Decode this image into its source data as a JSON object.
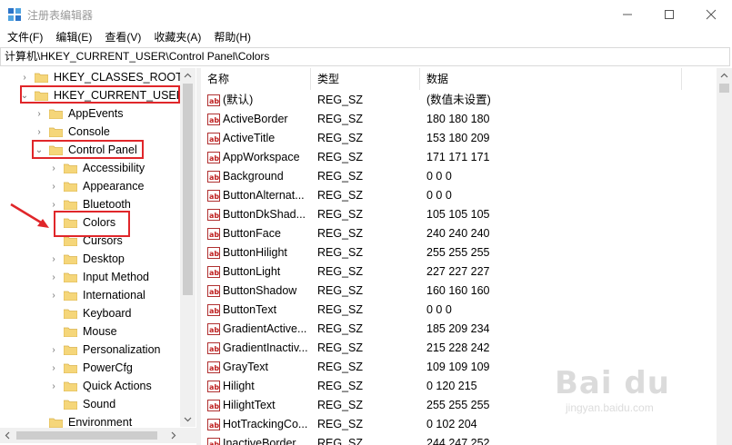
{
  "window": {
    "title": "注册表编辑器",
    "controls": {
      "minimize": "—",
      "maximize": "☐",
      "close": "✕"
    }
  },
  "menu": [
    "文件(F)",
    "编辑(E)",
    "查看(V)",
    "收藏夹(A)",
    "帮助(H)"
  ],
  "address": "计算机\\HKEY_CURRENT_USER\\Control Panel\\Colors",
  "tree": [
    {
      "label": "HKEY_CLASSES_ROOT",
      "toggle": "›"
    },
    {
      "label": "HKEY_CURRENT_USER",
      "toggle": "⌄"
    },
    {
      "label": "AppEvents",
      "toggle": "›"
    },
    {
      "label": "Console",
      "toggle": "›"
    },
    {
      "label": "Control Panel",
      "toggle": "⌄"
    },
    {
      "label": "Accessibility",
      "toggle": "›"
    },
    {
      "label": "Appearance",
      "toggle": "›"
    },
    {
      "label": "Bluetooth",
      "toggle": "›"
    },
    {
      "label": "Colors",
      "toggle": ""
    },
    {
      "label": "Cursors",
      "toggle": ""
    },
    {
      "label": "Desktop",
      "toggle": "›"
    },
    {
      "label": "Input Method",
      "toggle": "›"
    },
    {
      "label": "International",
      "toggle": "›"
    },
    {
      "label": "Keyboard",
      "toggle": ""
    },
    {
      "label": "Mouse",
      "toggle": ""
    },
    {
      "label": "Personalization",
      "toggle": "›"
    },
    {
      "label": "PowerCfg",
      "toggle": "›"
    },
    {
      "label": "Quick Actions",
      "toggle": "›"
    },
    {
      "label": "Sound",
      "toggle": ""
    },
    {
      "label": "Environment",
      "toggle": ""
    }
  ],
  "columns": {
    "name": "名称",
    "type": "类型",
    "data": "数据"
  },
  "values": [
    {
      "name": "(默认)",
      "type": "REG_SZ",
      "data": "(数值未设置)"
    },
    {
      "name": "ActiveBorder",
      "type": "REG_SZ",
      "data": "180 180 180"
    },
    {
      "name": "ActiveTitle",
      "type": "REG_SZ",
      "data": "153 180 209"
    },
    {
      "name": "AppWorkspace",
      "type": "REG_SZ",
      "data": "171 171 171"
    },
    {
      "name": "Background",
      "type": "REG_SZ",
      "data": "0 0 0"
    },
    {
      "name": "ButtonAlternat...",
      "type": "REG_SZ",
      "data": "0 0 0"
    },
    {
      "name": "ButtonDkShad...",
      "type": "REG_SZ",
      "data": "105 105 105"
    },
    {
      "name": "ButtonFace",
      "type": "REG_SZ",
      "data": "240 240 240"
    },
    {
      "name": "ButtonHilight",
      "type": "REG_SZ",
      "data": "255 255 255"
    },
    {
      "name": "ButtonLight",
      "type": "REG_SZ",
      "data": "227 227 227"
    },
    {
      "name": "ButtonShadow",
      "type": "REG_SZ",
      "data": "160 160 160"
    },
    {
      "name": "ButtonText",
      "type": "REG_SZ",
      "data": "0 0 0"
    },
    {
      "name": "GradientActive...",
      "type": "REG_SZ",
      "data": "185 209 234"
    },
    {
      "name": "GradientInactiv...",
      "type": "REG_SZ",
      "data": "215 228 242"
    },
    {
      "name": "GrayText",
      "type": "REG_SZ",
      "data": "109 109 109"
    },
    {
      "name": "Hilight",
      "type": "REG_SZ",
      "data": "0 120 215"
    },
    {
      "name": "HilightText",
      "type": "REG_SZ",
      "data": "255 255 255"
    },
    {
      "name": "HotTrackingCo...",
      "type": "REG_SZ",
      "data": "0 102 204"
    },
    {
      "name": "InactiveBorder",
      "type": "REG_SZ",
      "data": "244 247 252"
    }
  ],
  "watermark": {
    "main": "Bai du",
    "sub": "jingyan.baidu.com"
  },
  "colors": {
    "highlight_red": "#e0262a",
    "folder": "#f5d67a",
    "app_icon": "#2b74c9"
  }
}
